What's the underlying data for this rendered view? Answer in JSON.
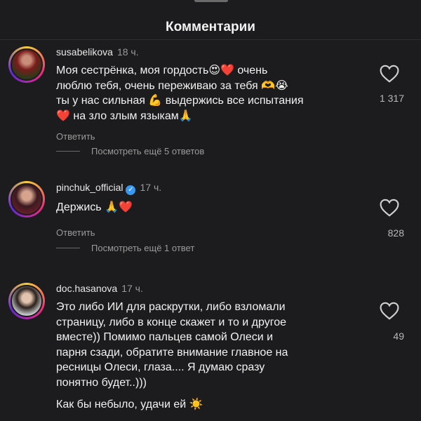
{
  "header": {
    "title": "Комментарии"
  },
  "comments": [
    {
      "username": "susabelikova",
      "time": "18 ч.",
      "lines": [
        "Моя сестрёнка, моя гордость😍❤️ очень",
        "люблю тебя, очень переживаю за тебя 🫶😭",
        "ты у нас сильная 💪 выдержись все испытания",
        "❤️ на зло злым языкам🙏"
      ],
      "reply_label": "Ответить",
      "more_replies": "Посмотреть ещё 5 ответов",
      "like_count": "1 317",
      "verified": false
    },
    {
      "username": "pinchuk_official",
      "time": "17 ч.",
      "lines": [
        "Держись 🙏❤️"
      ],
      "reply_label": "Ответить",
      "more_replies": "Посмотреть ещё 1 ответ",
      "like_count": "828",
      "verified": true
    },
    {
      "username": "doc.hasanova",
      "time": "17 ч.",
      "lines": [
        "Это либо ИИ для раскрутки, либо взломали",
        "страницу, либо в конце скажет и то и другое",
        "вместе)) Помимо пальцев самой Олеси и",
        "парня сзади, обратите внимание главное на",
        "ресницы Олеси, глаза.... Я думаю сразу",
        "понятно будет..)))"
      ],
      "extra_line": "Как бы небыло, удачи ей ☀️",
      "like_count": "49",
      "verified": false
    }
  ],
  "icons": {
    "like": "heart-outline-icon",
    "verified": "verified-badge-icon"
  },
  "colors": {
    "background": "#1c1c1e",
    "text": "#f2f2f2",
    "muted": "#9a9a9a",
    "verified": "#3897f0"
  }
}
